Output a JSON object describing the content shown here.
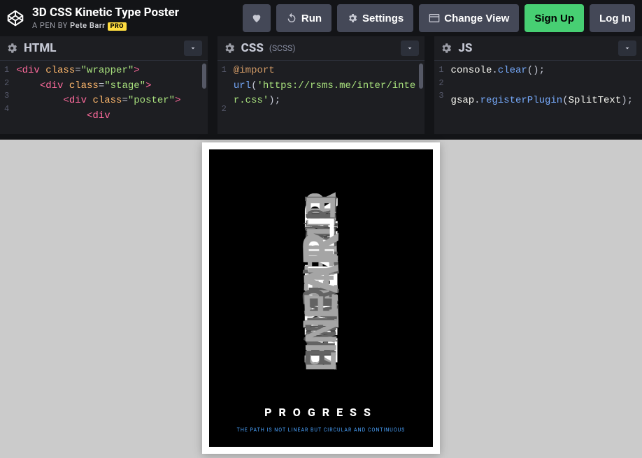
{
  "header": {
    "title": "3D CSS Kinetic Type Poster",
    "byline_prefix": "A PEN BY ",
    "author": "Pete Barr",
    "pro_badge": "PRO"
  },
  "toolbar": {
    "run": "Run",
    "settings": "Settings",
    "change_view": "Change View",
    "signup": "Sign Up",
    "login": "Log In"
  },
  "editors": {
    "html": {
      "title": "HTML",
      "gutter": [
        "1",
        "2",
        "3",
        "4"
      ],
      "lines": [
        "<div class=\"wrapper\">",
        "    <div class=\"stage\">",
        "        <div class=\"poster\">",
        "            <div"
      ]
    },
    "css": {
      "title": "CSS",
      "subtitle": "(SCSS)",
      "gutter": [
        "1",
        "",
        "",
        "2"
      ],
      "code_text": "@import url('https://rsms.me/inter/inter.css');"
    },
    "js": {
      "title": "JS",
      "gutter": [
        "1",
        "2",
        "3"
      ],
      "line1": "console.clear();",
      "line3": "gsap.registerPlugin(SplitText);"
    }
  },
  "poster": {
    "word": "LINEAR",
    "title": "PROGRESS",
    "subtitle": "THE PATH IS NOT LINEAR BUT CIRCULAR AND CONTINUOUS"
  }
}
